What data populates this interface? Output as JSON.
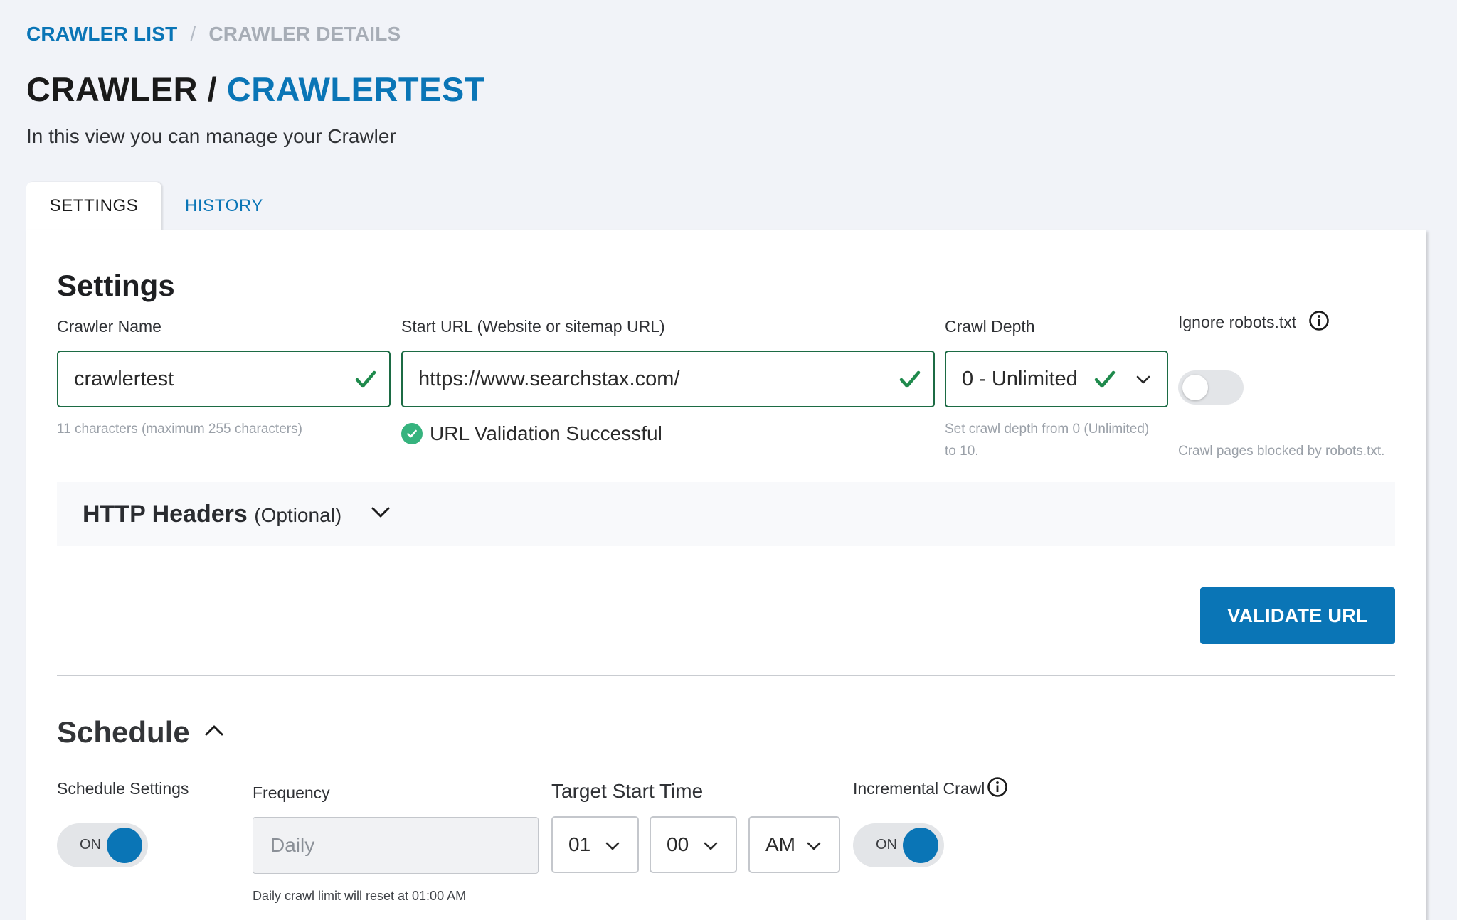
{
  "breadcrumb": {
    "items": [
      "CRAWLER LIST",
      "CRAWLER DETAILS"
    ],
    "separator": "/"
  },
  "header": {
    "title_prefix": "CRAWLER /",
    "title_name": "CRAWLERTEST",
    "subtitle": "In this view you can manage your Crawler"
  },
  "tabs": [
    {
      "label": "SETTINGS",
      "active": true
    },
    {
      "label": "HISTORY",
      "active": false
    }
  ],
  "settings": {
    "heading": "Settings",
    "crawler_name": {
      "label": "Crawler Name",
      "value": "crawlertest",
      "helper": "11 characters (maximum 255 characters)"
    },
    "start_url": {
      "label": "Start URL (Website or sitemap URL)",
      "value": "https://www.searchstax.com/",
      "validation": "URL Validation Successful"
    },
    "crawl_depth": {
      "label": "Crawl Depth",
      "value": "0 - Unlimited",
      "helper_line1": "Set crawl depth from 0 (Unlimited)",
      "helper_line2": "to 10."
    },
    "ignore_robots": {
      "label": "Ignore robots.txt",
      "enabled": false,
      "helper": "Crawl pages blocked by robots.txt."
    },
    "http_headers": {
      "title": "HTTP Headers",
      "optional": "(Optional)",
      "expanded": false
    },
    "validate_button": "VALIDATE URL"
  },
  "schedule": {
    "heading": "Schedule",
    "expanded": true,
    "schedule_settings": {
      "label": "Schedule Settings",
      "toggle_text": "ON",
      "enabled": true
    },
    "frequency": {
      "label": "Frequency",
      "value": "Daily",
      "helper": "Daily crawl limit will reset at 01:00 AM"
    },
    "target_start_time": {
      "label": "Target Start Time",
      "hour": "01",
      "minute": "00",
      "period": "AM"
    },
    "incremental_crawl": {
      "label": "Incremental Crawl",
      "toggle_text": "ON",
      "enabled": true
    }
  },
  "colors": {
    "accent": "#0a75b6",
    "valid_border": "#1c6b44",
    "check": "#1f8a4c",
    "success_dot": "#36b37e"
  },
  "icons": [
    "check-icon",
    "success-check-icon",
    "info-icon",
    "chevron-down-icon",
    "chevron-up-icon"
  ]
}
